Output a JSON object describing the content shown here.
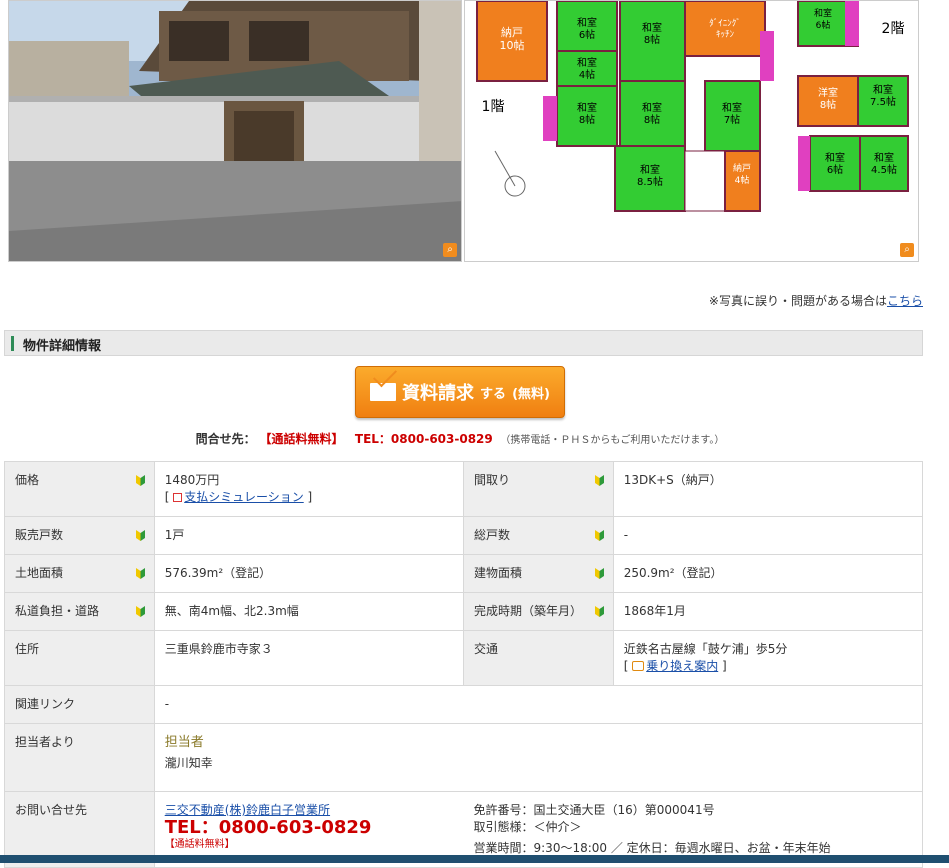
{
  "floorplan": {
    "floor1_label": "1階",
    "floor2_label": "2階",
    "rooms_floor1": [
      {
        "name": "納戸",
        "size": "10帖"
      },
      {
        "name": "和室",
        "size": "6帖"
      },
      {
        "name": "和室",
        "size": "8帖"
      },
      {
        "name": "ﾀﾞｲﾆﾝｸﾞ",
        "size": "ｷｯﾁﾝ"
      },
      {
        "name": "和室",
        "size": "4帖"
      },
      {
        "name": "和室",
        "size": "8帖"
      },
      {
        "name": "和室",
        "size": "8帖"
      },
      {
        "name": "和室",
        "size": "7帖"
      },
      {
        "name": "和室",
        "size": "8.5帖"
      },
      {
        "name": "納戸",
        "size": "4帖"
      }
    ],
    "rooms_floor2": [
      {
        "name": "和室",
        "size": "6帖"
      },
      {
        "name": "洋室",
        "size": "8帖"
      },
      {
        "name": "和室",
        "size": "7.5帖"
      },
      {
        "name": "和室",
        "size": "6帖"
      },
      {
        "name": "和室",
        "size": "4.5帖"
      }
    ],
    "colors": {
      "orange": "#f07f1e",
      "green": "#33cc33",
      "magenta": "#e040c0",
      "wall": "#7a2040"
    }
  },
  "notice": {
    "text": "※写真に誤り・問題がある場合は",
    "link": "こちら"
  },
  "section_title": "物件詳細情報",
  "request_button": {
    "main": "資料請求",
    "sub": "する",
    "free": "(無料)"
  },
  "contact_line": {
    "label": "問合せ先：",
    "free": "【通話料無料】",
    "tel": "TEL：0800-603-0829",
    "note": "（携帯電話・ＰＨＳからもご利用いただけます。）"
  },
  "spec": {
    "price_label": "価格",
    "price": "1480万円",
    "price_sim": "支払シミュレーション",
    "layout_label": "間取り",
    "layout": "13DK+S（納戸）",
    "units_label": "販売戸数",
    "units": "1戸",
    "total_units_label": "総戸数",
    "total_units": "-",
    "land_label": "土地面積",
    "land": "576.39m²（登記）",
    "building_label": "建物面積",
    "building": "250.9m²（登記）",
    "road_label": "私道負担・道路",
    "road": "無、南4m幅、北2.3m幅",
    "built_label": "完成時期（築年月）",
    "built": "1868年1月",
    "address_label": "住所",
    "address": "三重県鈴鹿市寺家３",
    "transport_label": "交通",
    "transport": "近鉄名古屋線「鼓ケ浦」歩5分",
    "transfer": "乗り換え案内",
    "related_label": "関連リンク",
    "related": "-",
    "staff_label": "担当者より",
    "staff_role": "担当者",
    "staff_name": "瀧川知幸",
    "inquiry_label": "お問い合せ先",
    "company": "三交不動産(株)鈴鹿白子営業所",
    "company_tel": "TEL：0800-603-0829",
    "company_free": "【通話料無料】",
    "license": "免許番号：国土交通大臣（16）第000041号",
    "deal": "取引態様：＜仲介＞",
    "hours": "営業時間：9:30～18:00 ／ 定休日：毎週水曜日、お盆・年末年始"
  }
}
